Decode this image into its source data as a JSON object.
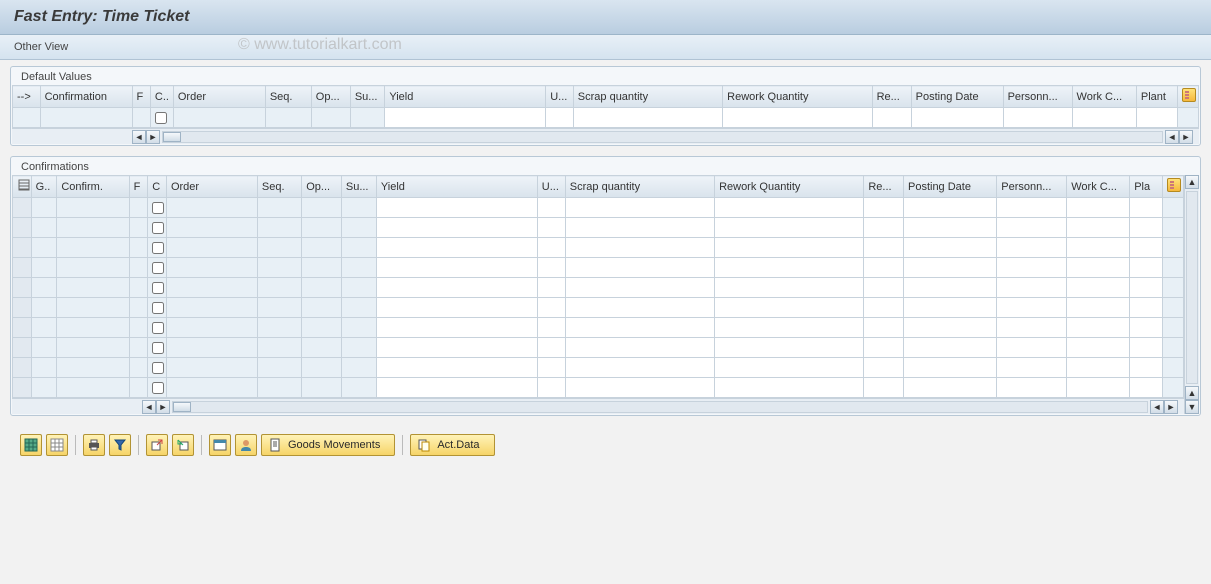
{
  "title": "Fast Entry: Time Ticket",
  "watermark": "© www.tutorialkart.com",
  "sub_toolbar": {
    "other_view": "Other View"
  },
  "default_values": {
    "title": "Default Values",
    "arrow": "-->",
    "columns": [
      "Confirmation",
      "F",
      "C..",
      "Order",
      "Seq.",
      "Op...",
      "Su...",
      "Yield",
      "U...",
      "Scrap quantity",
      "Rework Quantity",
      "Re...",
      "Posting Date",
      "Personn...",
      "Work C...",
      "Plant"
    ]
  },
  "confirmations": {
    "title": "Confirmations",
    "columns": [
      "G..",
      "Confirm.",
      "F",
      "C",
      "Order",
      "Seq.",
      "Op...",
      "Su...",
      "Yield",
      "U...",
      "Scrap quantity",
      "Rework Quantity",
      "Re...",
      "Posting Date",
      "Personn...",
      "Work C...",
      "Pla"
    ],
    "row_count": 10
  },
  "buttons": {
    "goods_movements": "Goods Movements",
    "act_data": "Act.Data"
  },
  "icons": {
    "select_all": "select-all-icon",
    "deselect_all": "deselect-all-icon",
    "print": "print-icon",
    "filter": "filter-icon",
    "export": "export-icon",
    "import": "import-icon",
    "layout": "layout-icon",
    "user": "user-icon",
    "doc": "doc-icon",
    "copy": "copy-icon"
  }
}
